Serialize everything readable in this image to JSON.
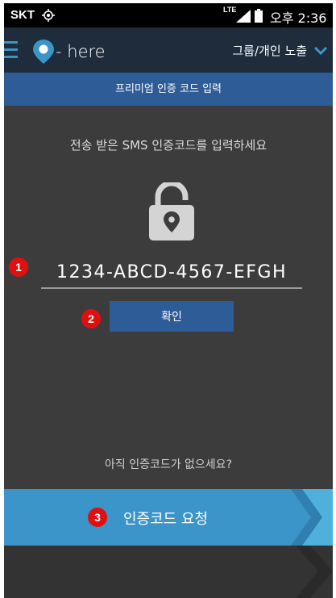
{
  "status_bar": {
    "carrier": "SKT",
    "network_type": "LTE",
    "time": "오후 2:36"
  },
  "app_bar": {
    "logo_text": "- here",
    "exposure_menu_label": "그룹/개인 노출",
    "icons": [
      "hamburger-icon",
      "logo-pin-icon",
      "chevron-down-icon"
    ]
  },
  "subheader": {
    "title": "프리미엄 인증 코드 입력"
  },
  "main": {
    "instruction": "전송 받은 SMS 인증코드를 입력하세요",
    "code_input_value": "1234-ABCD-4567-EFGH",
    "confirm_button_label": "확인",
    "no_code_text": "아직 인증코드가 없으세요?",
    "request_button_label": "인증코드 요청"
  },
  "annotations": {
    "badges": [
      "1",
      "2",
      "3"
    ]
  },
  "colors": {
    "app_bar": "#1e2c3c",
    "accent_blue": "#2e5c97",
    "background": "#3c3c3c",
    "request_button": "#3b95c8",
    "badge_red": "#e01010"
  }
}
